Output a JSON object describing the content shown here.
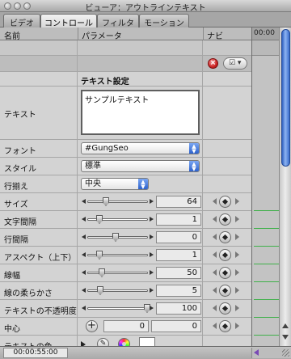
{
  "window": {
    "title": "ビューア：アウトラインテキスト"
  },
  "tabs": [
    {
      "label": "ビデオ",
      "active": false
    },
    {
      "label": "コントロール",
      "active": true
    },
    {
      "label": "フィルタ",
      "active": false
    },
    {
      "label": "モーション",
      "active": false
    }
  ],
  "columns": {
    "name": "名前",
    "parameter": "パラメータ",
    "nav": "ナビ",
    "timecode": "00:00"
  },
  "controls": {
    "reset_symbol": "×",
    "nav_menu_symbol": "☑ ▾"
  },
  "section": {
    "title": "テキスト設定"
  },
  "text_param": {
    "label": "テキスト",
    "value": "サンプルテキスト"
  },
  "font": {
    "label": "フォント",
    "value": "#GungSeo"
  },
  "style": {
    "label": "スタイル",
    "value": "標準"
  },
  "alignment": {
    "label": "行揃え",
    "value": "中央"
  },
  "sliders": [
    {
      "label": "サイズ",
      "value": "64"
    },
    {
      "label": "文字間隔",
      "value": "1"
    },
    {
      "label": "行間隔",
      "value": "0"
    },
    {
      "label": "アスペクト（上下）",
      "value": "1"
    },
    {
      "label": "線幅",
      "value": "50"
    },
    {
      "label": "線の柔らかさ",
      "value": "5"
    },
    {
      "label": "テキストの不透明度",
      "value": "100"
    }
  ],
  "center": {
    "label": "中心",
    "plus_symbol": "+",
    "x": "0",
    "y": "0"
  },
  "text_color": {
    "label": "テキストの色",
    "eyedropper_symbol": "✎",
    "swatch_color": "#ffffff"
  },
  "status": {
    "timecode": "00:00:55:00"
  },
  "colors": {
    "accent": "#2d62cc",
    "keyframe_line": "#3fb04a",
    "reset": "#cc2222"
  }
}
